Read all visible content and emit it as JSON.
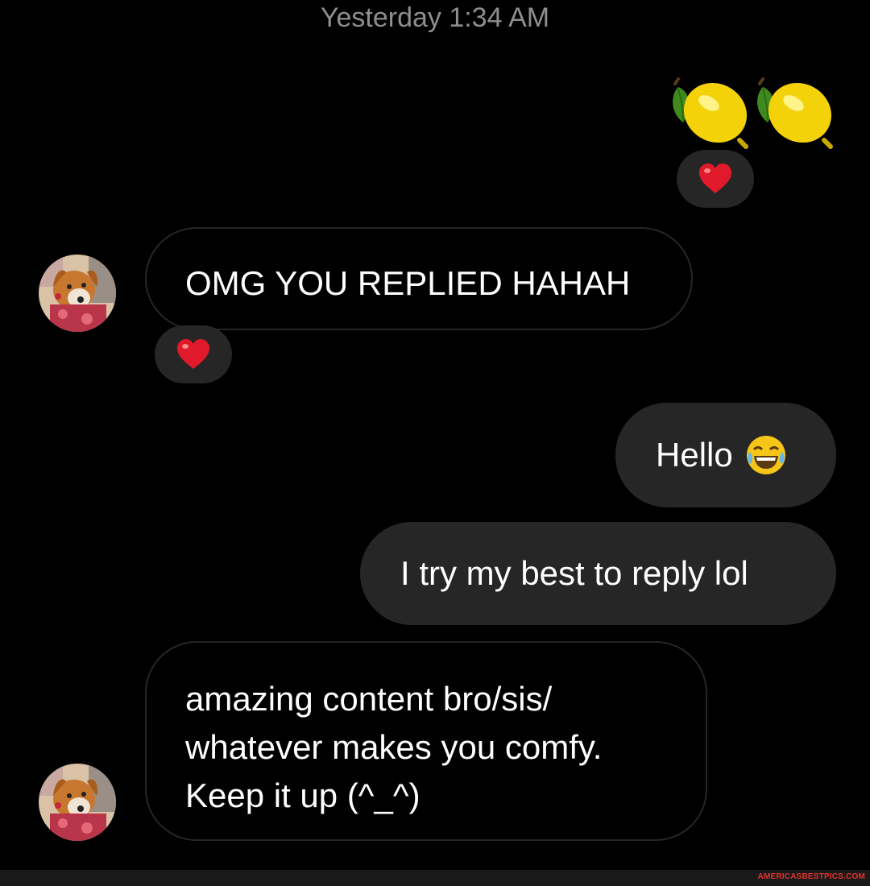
{
  "timestamp": "Yesterday 1:34 AM",
  "messages": [
    {
      "sender": "me",
      "content": "lemon-emoji lemon-emoji",
      "reaction": "heart-emoji"
    },
    {
      "sender": "them",
      "text": "OMG YOU REPLIED HAHAH",
      "reaction": "heart-emoji"
    },
    {
      "sender": "me",
      "text": "Hello",
      "emoji": "tears-of-joy-emoji"
    },
    {
      "sender": "me",
      "text": "I try my best to reply lol"
    },
    {
      "sender": "them",
      "lines": [
        "amazing content bro/sis/",
        "whatever makes you comfy.",
        "Keep it up (^_^)"
      ]
    }
  ],
  "watermark": "AMERICASBESTPICS.COM",
  "colors": {
    "background": "#000000",
    "bubble": "#262626",
    "timestamp": "#8e8e8e",
    "heart": "#e0192b",
    "watermark": "#e0322b"
  }
}
